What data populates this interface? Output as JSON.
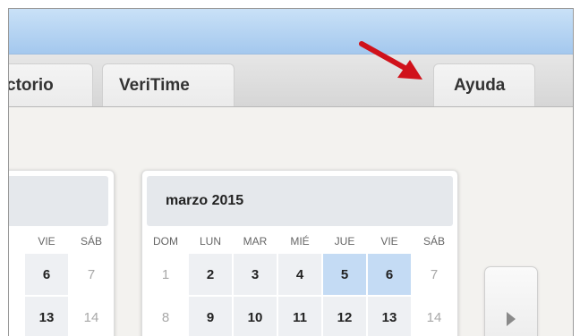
{
  "tabs": [
    {
      "label": "ctorio"
    },
    {
      "label": "VeriTime"
    },
    {
      "label": "Ayuda"
    }
  ],
  "calendar_prev": {
    "weekdays": [
      "VIE",
      "SÁB"
    ],
    "rows": [
      [
        "6",
        "7"
      ],
      [
        "13",
        "14"
      ]
    ]
  },
  "calendar_main": {
    "title": "marzo 2015",
    "weekdays": [
      "DOM",
      "LUN",
      "MAR",
      "MIÉ",
      "JUE",
      "VIE",
      "SÁB"
    ],
    "rows": [
      [
        "1",
        "2",
        "3",
        "4",
        "5",
        "6",
        "7"
      ],
      [
        "8",
        "9",
        "10",
        "11",
        "12",
        "13",
        "14"
      ]
    ],
    "highlighted_days": [
      "5",
      "6"
    ]
  },
  "icons": {
    "pointer_arrow": "red-arrow-icon",
    "next": "triangle-right-icon"
  },
  "colors": {
    "arrow": "#d0121b",
    "highlight": "#c4dbf4",
    "topbar": "#a4c8ee"
  }
}
